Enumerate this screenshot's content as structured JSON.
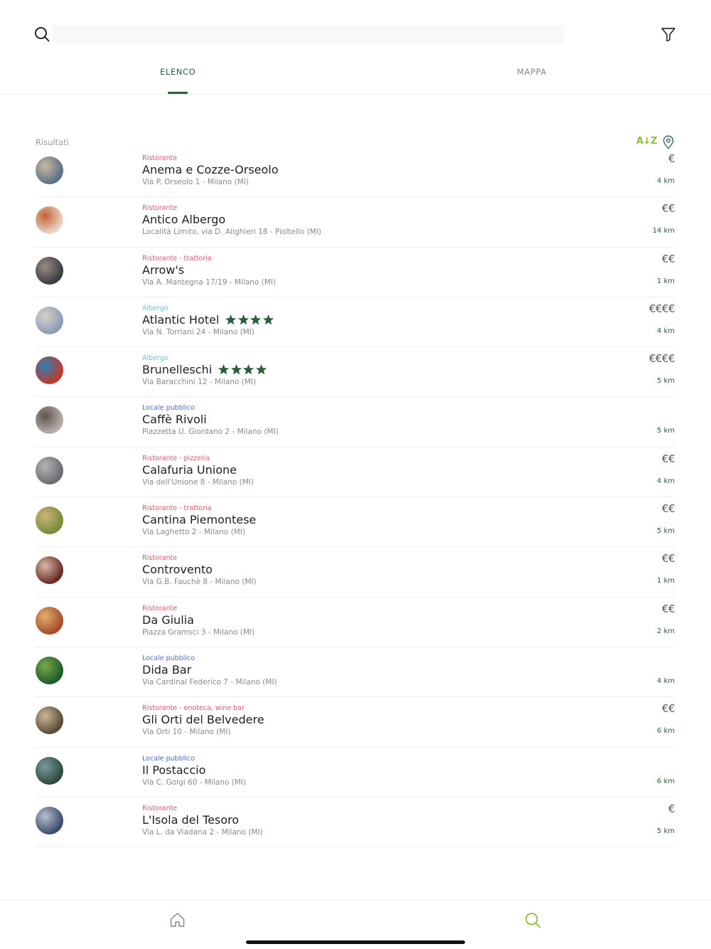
{
  "colors": {
    "accent": "#2a5f3e",
    "sort_accent": "#8bbd3a",
    "category_ristorante": "#e0546a",
    "category_albergo": "#6ec3dc",
    "category_locale": "#4a6fc7"
  },
  "search": {
    "placeholder": "",
    "value": ""
  },
  "tabs": [
    {
      "label": "ELENCO",
      "active": true
    },
    {
      "label": "MAPPA",
      "active": false
    }
  ],
  "results": {
    "label": "Risultati",
    "sort_label": "A↓Z"
  },
  "items": [
    {
      "category": "Ristorante",
      "category_color": "#e0546a",
      "name": "Anema e Cozze-Orseolo",
      "stars": 0,
      "address": "Via P. Orseolo 1 - Milano (MI)",
      "price": "€",
      "distance": "4 km"
    },
    {
      "category": "Ristorante",
      "category_color": "#e0546a",
      "name": "Antico Albergo",
      "stars": 0,
      "address": "Località Limito, via D. Alighieri 18 - Pioltello (MI)",
      "price": "€€",
      "distance": "14 km"
    },
    {
      "category": "Ristorante - trattoria",
      "category_color": "#e0546a",
      "name": "Arrow's",
      "stars": 0,
      "address": "Via A. Mantegna 17/19 - Milano (MI)",
      "price": "€€",
      "distance": "1 km"
    },
    {
      "category": "Albergo",
      "category_color": "#6ec3dc",
      "name": "Atlantic Hotel",
      "stars": 4,
      "address": "Via N. Torriani 24 - Milano (MI)",
      "price": "€€€€",
      "distance": "4 km"
    },
    {
      "category": "Albergo",
      "category_color": "#6ec3dc",
      "name": "Brunelleschi",
      "stars": 4,
      "address": "Via Baracchini 12 - Milano (MI)",
      "price": "€€€€",
      "distance": "5 km"
    },
    {
      "category": "Locale pubblico",
      "category_color": "#4a6fc7",
      "name": "Caffè Rivoli",
      "stars": 0,
      "address": "Piazzetta U. Giordano 2 - Milano (MI)",
      "price": "",
      "distance": "5 km"
    },
    {
      "category": "Ristorante - pizzeria",
      "category_color": "#e0546a",
      "name": "Calafuria Unione",
      "stars": 0,
      "address": "Via dell'Unione 8 - Milano (MI)",
      "price": "€€",
      "distance": "4 km"
    },
    {
      "category": "Ristorante - trattoria",
      "category_color": "#e0546a",
      "name": "Cantina Piemontese",
      "stars": 0,
      "address": "Via Laghetto 2 - Milano (MI)",
      "price": "€€",
      "distance": "5 km"
    },
    {
      "category": "Ristorante",
      "category_color": "#e0546a",
      "name": "Controvento",
      "stars": 0,
      "address": "Via G.B. Fauchè 8 - Milano (MI)",
      "price": "€€",
      "distance": "1 km"
    },
    {
      "category": "Ristorante",
      "category_color": "#e0546a",
      "name": "Da Giulia",
      "stars": 0,
      "address": "Piazza Gramsci 3 - Milano (MI)",
      "price": "€€",
      "distance": "2 km"
    },
    {
      "category": "Locale pubblico",
      "category_color": "#4a6fc7",
      "name": "Dida Bar",
      "stars": 0,
      "address": "Via Cardinal Federico 7 - Milano (MI)",
      "price": "",
      "distance": "4 km"
    },
    {
      "category": "Ristorante - enoteca, wine bar",
      "category_color": "#e0546a",
      "name": "Gli Orti del Belvedere",
      "stars": 0,
      "address": "Via Orti 10 - Milano (MI)",
      "price": "€€",
      "distance": "6 km"
    },
    {
      "category": "Locale pubblico",
      "category_color": "#4a6fc7",
      "name": "Il Postaccio",
      "stars": 0,
      "address": "Via C. Golgi 60 - Milano (MI)",
      "price": "",
      "distance": "6 km"
    },
    {
      "category": "Ristorante",
      "category_color": "#e0546a",
      "name": "L'Isola del Tesoro",
      "stars": 0,
      "address": "Via L. da Viadana 2 - Milano (MI)",
      "price": "€",
      "distance": "5 km"
    }
  ],
  "avatar_colors": [
    [
      "#5b6f86",
      "#c7b9a0"
    ],
    [
      "#e8d8c8",
      "#c4623a"
    ],
    [
      "#3a3d44",
      "#9a8c80"
    ],
    [
      "#8a9bb8",
      "#d9d2c6"
    ],
    [
      "#c0392b",
      "#2f7fb5"
    ],
    [
      "#b9b0aa",
      "#5e5550"
    ],
    [
      "#6c6c70",
      "#b4b4b8"
    ],
    [
      "#7a8a3a",
      "#c9b47a"
    ],
    [
      "#6b2a24",
      "#d8b8a8"
    ],
    [
      "#a84a2a",
      "#e0b070"
    ],
    [
      "#1f5a2a",
      "#7aa84a"
    ],
    [
      "#5a4a36",
      "#c8b898"
    ],
    [
      "#2f4a3a",
      "#7a9aa0"
    ],
    [
      "#3a4a6a",
      "#b8c0d0"
    ]
  ],
  "bottom_nav": [
    {
      "icon": "home-icon",
      "active": false
    },
    {
      "icon": "search-icon",
      "active": true
    }
  ]
}
